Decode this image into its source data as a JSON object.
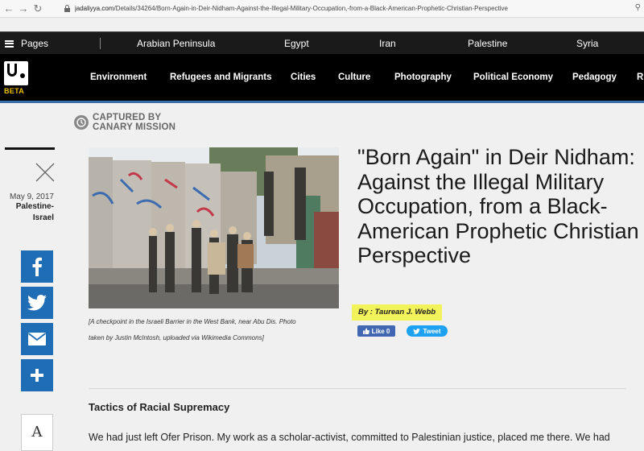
{
  "browser": {
    "url_host": "jadaliyya.com",
    "url_path": "/Details/34264/Born-Again-in-Deir-Nidham-Against-the-Illegal-Military-Occupation,-from-a-Black-American-Prophetic-Christian-Perspective"
  },
  "top_nav": {
    "pages_label": "Pages",
    "links": [
      "Arabian Peninsula",
      "Egypt",
      "Iran",
      "Palestine",
      "Syria"
    ]
  },
  "section_nav": {
    "beta_label": "BETA",
    "links": [
      "Environment",
      "Refugees and Migrants",
      "Cities",
      "Culture",
      "Photography",
      "Political Economy",
      "Pedagogy",
      "R"
    ]
  },
  "captured": {
    "line1": "CAPTURED BY",
    "line2": "CANARY MISSION"
  },
  "meta": {
    "date": "May 9, 2017",
    "category_line1": "Palestine-",
    "category_line2": "Israel"
  },
  "photo_caption_line1": "[A checkpoint in the Israeli Barrier in the West Bank, near Abu Dis. Photo",
  "photo_caption_line2": "taken by Justin McIntosh, uploaded via Wikimedia Commons]",
  "article": {
    "title": "\"Born Again\" in Deir Nidham: Against the Illegal Military Occupation, from a Black-American Prophetic Christian Perspective",
    "byline": "By : Taurean J. Webb",
    "like_label": "Like 0",
    "tweet_label": "Tweet",
    "subhead": "Tactics of Racial Supremacy",
    "body_first_line": "We had just left Ofer Prison. My work as a scholar-activist, committed to Palestinian justice, placed me there. We had"
  },
  "font_button_label": "A",
  "colors": {
    "share_blue": "#1f6db5",
    "byline_highlight": "#f2f25a",
    "nav_accent": "#3a6ea8",
    "beta": "#f0c000"
  }
}
